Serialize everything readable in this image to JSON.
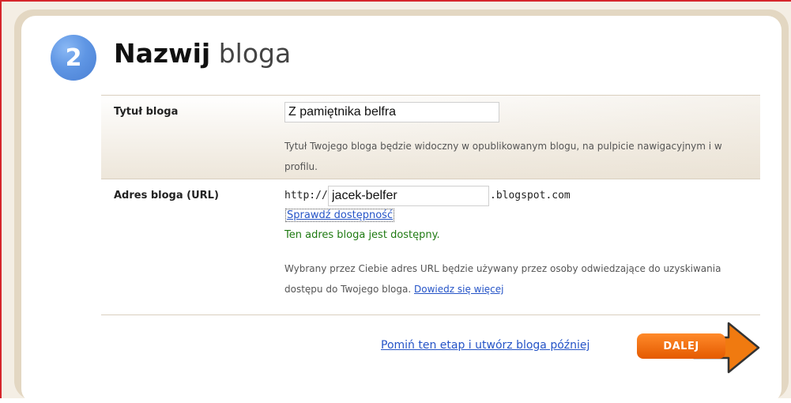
{
  "step": {
    "number": "2",
    "title_bold": "Nazwij",
    "title_rest": "bloga"
  },
  "blog_title": {
    "label": "Tytuł bloga",
    "value": "Z pamiętnika belfra",
    "help": "Tytuł Twojego bloga będzie widoczny w opublikowanym blogu, na pulpicie nawigacyjnym i w profilu."
  },
  "blog_address": {
    "label": "Adres bloga (URL)",
    "prefix": "http://",
    "value": "jacek-belfer",
    "suffix": ".blogspot.com",
    "check_link": "Sprawdź dostępność",
    "status": "Ten adres bloga jest dostępny.",
    "help": "Wybrany przez Ciebie adres URL będzie używany przez osoby odwiedzające do uzyskiwania dostępu do Twojego bloga.",
    "learn_more": "Dowiedz się więcej"
  },
  "actions": {
    "skip_link": "Pomiń ten etap i utwórz bloga później",
    "next_button": "DALEJ"
  },
  "colors": {
    "accent_orange": "#f07a10",
    "link_blue": "#2554c7",
    "success_green": "#1f7a12",
    "frame_red": "#d6262b"
  }
}
